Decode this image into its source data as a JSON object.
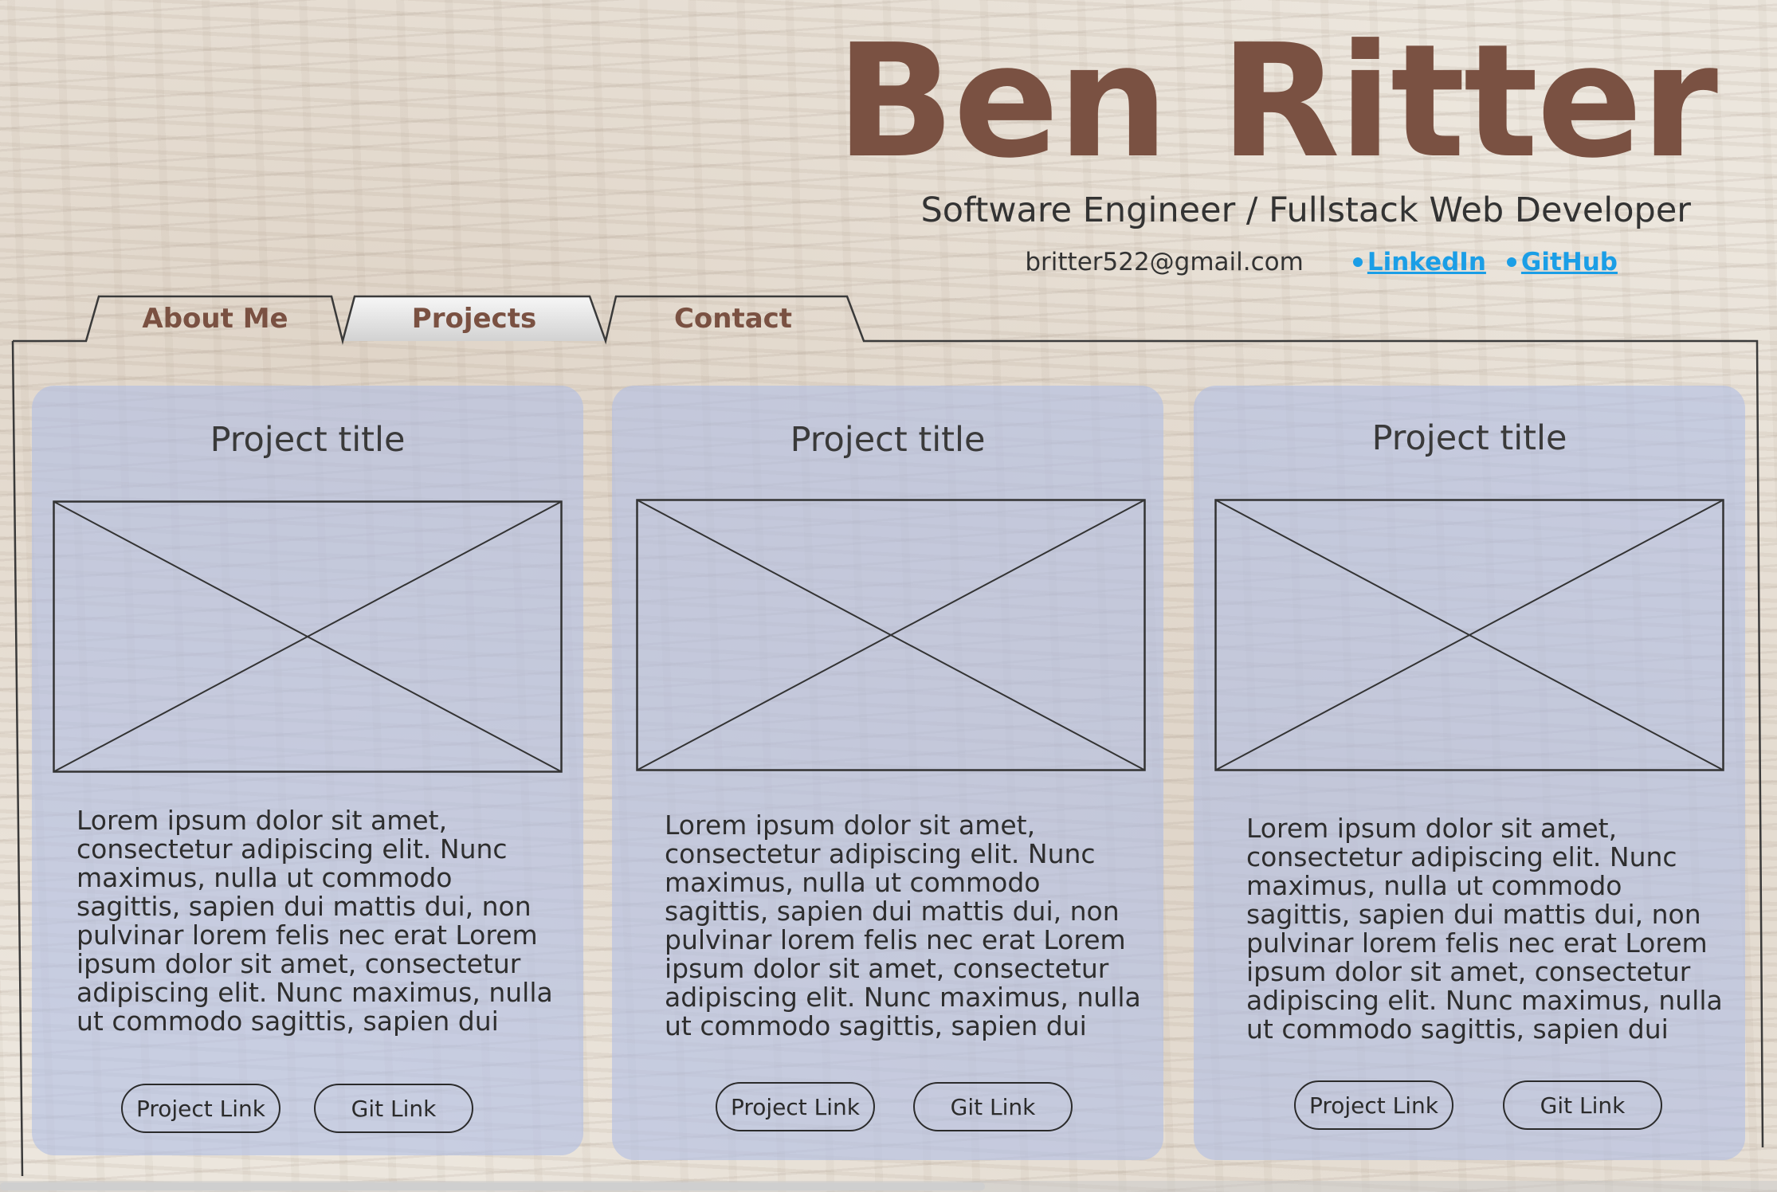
{
  "header": {
    "name": "Ben Ritter",
    "subtitle": "Software Engineer / Fullstack Web Developer",
    "email": "britter522@gmail.com",
    "links": {
      "linkedin": "LinkedIn",
      "github": "GitHub"
    }
  },
  "tabs": {
    "about": "About Me",
    "projects": "Projects",
    "contact": "Contact"
  },
  "projects": [
    {
      "title": "Project title",
      "description": "Lorem ipsum dolor sit amet, consectetur adipiscing elit. Nunc maximus, nulla ut commodo sagittis, sapien dui mattis dui, non pulvinar lorem felis nec erat Lorem ipsum dolor sit amet, consectetur adipiscing elit. Nunc maximus, nulla ut commodo sagittis, sapien dui",
      "project_link": "Project Link",
      "git_link": "Git Link"
    },
    {
      "title": "Project title",
      "description": "Lorem ipsum dolor sit amet, consectetur adipiscing elit. Nunc maximus, nulla ut commodo sagittis, sapien dui mattis dui, non pulvinar lorem felis nec erat Lorem ipsum dolor sit amet, consectetur adipiscing elit. Nunc maximus, nulla ut commodo sagittis, sapien dui",
      "project_link": "Project Link",
      "git_link": "Git Link"
    },
    {
      "title": "Project title",
      "description": "Lorem ipsum dolor sit amet, consectetur adipiscing elit. Nunc maximus, nulla ut commodo sagittis, sapien dui mattis dui, non pulvinar lorem felis nec erat Lorem ipsum dolor sit amet, consectetur adipiscing elit. Nunc maximus, nulla ut commodo sagittis, sapien dui",
      "project_link": "Project Link",
      "git_link": "Git Link"
    }
  ],
  "colors": {
    "name": "#7a5142",
    "link": "#1b9ee6",
    "card": "#b2bee4"
  }
}
